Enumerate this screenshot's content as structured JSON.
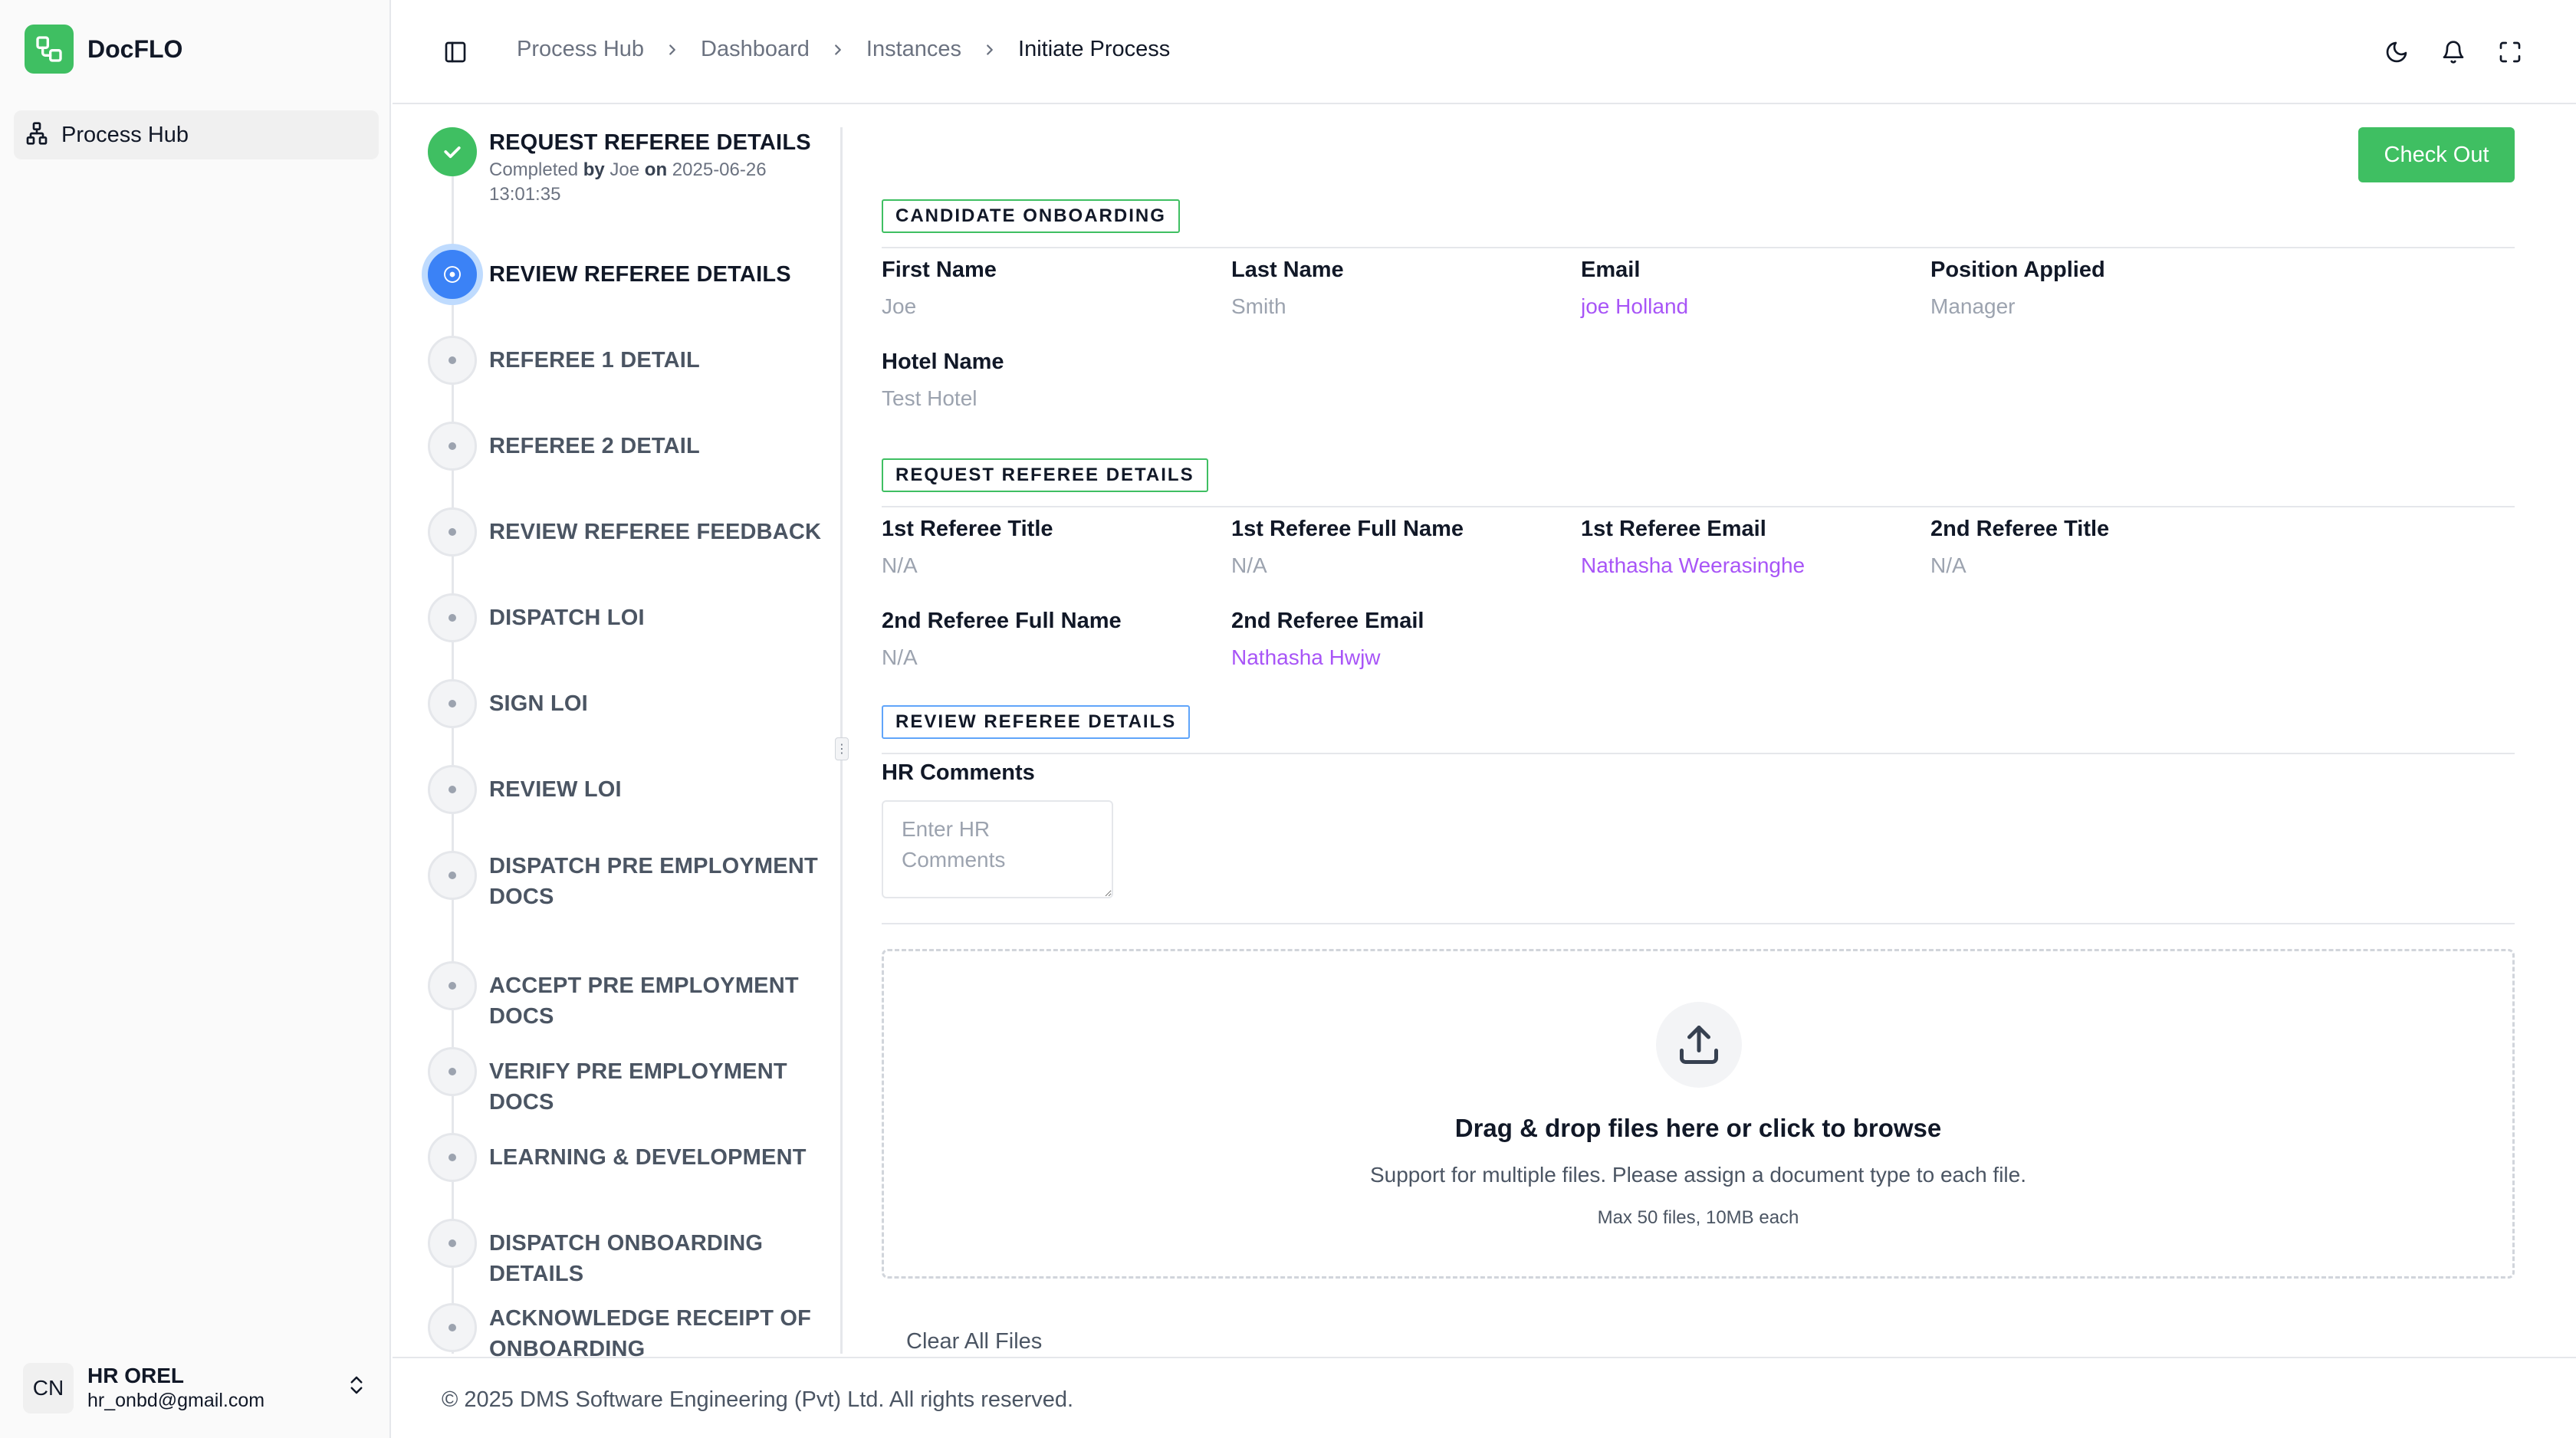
{
  "app": {
    "name": "DocFLO",
    "brand_color": "#3fbf62",
    "logo_icon": "workflow-icon"
  },
  "sidebar": {
    "items": [
      {
        "label": "Process Hub",
        "icon": "sitemap-icon",
        "active": true
      }
    ],
    "user": {
      "initials": "CN",
      "name": "HR OREL",
      "email": "hr_onbd@gmail.com"
    }
  },
  "header": {
    "breadcrumbs": [
      "Process Hub",
      "Dashboard",
      "Instances",
      "Initiate Process"
    ],
    "icons": [
      "moon-icon",
      "bell-icon",
      "fullscreen-icon"
    ]
  },
  "stepper": {
    "steps": [
      {
        "title": "REQUEST REFEREE DETAILS",
        "status": "done",
        "meta_prefix": "Completed",
        "meta_by": "by",
        "meta_user": "Joe",
        "meta_on": "on",
        "meta_date": "2025-06-26",
        "meta_time": "13:01:35"
      },
      {
        "title": "REVIEW REFEREE DETAILS",
        "status": "active"
      },
      {
        "title": "REFEREE 1 DETAIL",
        "status": "pending"
      },
      {
        "title": "REFEREE 2 DETAIL",
        "status": "pending"
      },
      {
        "title": "REVIEW REFEREE FEEDBACK",
        "status": "pending"
      },
      {
        "title": "DISPATCH LOI",
        "status": "pending"
      },
      {
        "title": "SIGN LOI",
        "status": "pending"
      },
      {
        "title": "REVIEW LOI",
        "status": "pending"
      },
      {
        "title": "DISPATCH PRE EMPLOYMENT DOCS",
        "status": "pending"
      },
      {
        "title": "ACCEPT PRE EMPLOYMENT DOCS",
        "status": "pending"
      },
      {
        "title": "VERIFY PRE EMPLOYMENT DOCS",
        "status": "pending"
      },
      {
        "title": "LEARNING & DEVELOPMENT",
        "status": "pending"
      },
      {
        "title": "DISPATCH ONBOARDING DETAILS",
        "status": "pending"
      },
      {
        "title": "ACKNOWLEDGE RECEIPT OF ONBOARDING",
        "status": "pending"
      }
    ]
  },
  "main": {
    "checkout_label": "Check Out",
    "sections": {
      "candidate": {
        "title": "CANDIDATE ONBOARDING",
        "fields": [
          {
            "label": "First Name",
            "value": "Joe"
          },
          {
            "label": "Last Name",
            "value": "Smith"
          },
          {
            "label": "Email",
            "value": "joe Holland"
          },
          {
            "label": "Position Applied",
            "value": "Manager"
          },
          {
            "label": "Hotel Name",
            "value": "Test Hotel"
          }
        ]
      },
      "request": {
        "title": "REQUEST REFEREE DETAILS",
        "fields": [
          {
            "label": "1st Referee Title",
            "value": "N/A"
          },
          {
            "label": "1st Referee Full Name",
            "value": "N/A"
          },
          {
            "label": "1st Referee Email",
            "value": "Nathasha Weerasinghe"
          },
          {
            "label": "2nd Referee Title",
            "value": "N/A"
          },
          {
            "label": "2nd Referee Full Name",
            "value": "N/A"
          },
          {
            "label": "2nd Referee Email",
            "value": "Nathasha Hwjw"
          }
        ]
      },
      "review": {
        "title": "REVIEW REFEREE DETAILS",
        "comments_label": "HR Comments",
        "comments_placeholder": "Enter HR Comments",
        "comments_value": ""
      }
    },
    "upload": {
      "title": "Drag & drop files here or click to browse",
      "subtitle": "Support for multiple files. Please assign a document type to each file.",
      "limit": "Max 50 files, 10MB each",
      "icon": "upload-icon",
      "clear_label": "Clear All Files"
    },
    "link_color": "#a855f7"
  },
  "footer": {
    "text": "© 2025 DMS Software Engineering (Pvt) Ltd. All rights reserved."
  }
}
